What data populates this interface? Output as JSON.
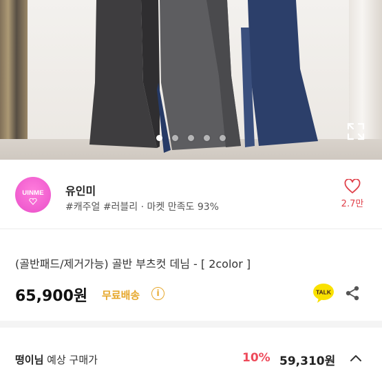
{
  "gallery": {
    "image_alt": "골반 부츠컷 데님 상품 이미지",
    "dot_count": 5,
    "active_dot": 0
  },
  "seller": {
    "logo_text": "UINME",
    "name": "유인미",
    "tags": "#캐주얼 #러블리 · 마켓 만족도 93%",
    "favorite_count": "2.7만"
  },
  "product": {
    "title": "(골반패드/제거가능) 골반 부츠컷 데님 - [ 2color ]",
    "price": "65,900원",
    "shipping": "무료배송",
    "info_symbol": "i",
    "talk_label": "TALK"
  },
  "expected_price": {
    "user": "떵이님",
    "label": " 예상 구매가",
    "discount": "10%",
    "price": "59,310원"
  },
  "colors": {
    "brand_pink": "#e94fc9",
    "heart_red": "#e0404a",
    "free_ship_orange": "#e6a72b",
    "discount_red": "#ee4a5a",
    "talk_yellow": "#fae100"
  }
}
